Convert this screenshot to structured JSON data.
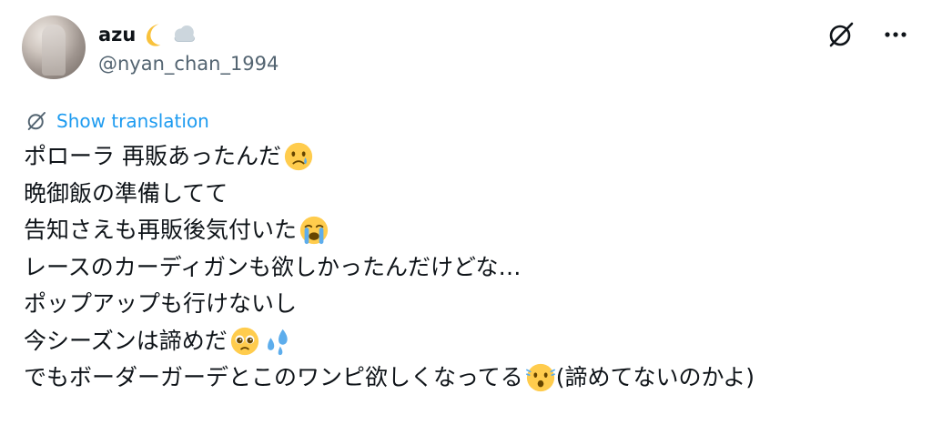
{
  "author": {
    "display_name": "azu",
    "name_emojis": [
      "crescent-moon-icon",
      "cloud-icon"
    ],
    "handle": "@nyan_chan_1994"
  },
  "actions": {
    "grok_icon": "grok-icon",
    "more_icon": "more-icon"
  },
  "translation": {
    "label": "Show translation"
  },
  "tweet": {
    "lines": [
      {
        "text": "ポローラ 再販あったんだ",
        "emoji": "crying-face-icon"
      },
      {
        "text": "晩御飯の準備してて",
        "emoji": ""
      },
      {
        "text": "告知さえも再販後気付いた",
        "emoji": "loudly-crying-face-icon"
      },
      {
        "text": "レースのカーディガンも欲しかったんだけどな…",
        "emoji": ""
      },
      {
        "text": "ポップアップも行けないし",
        "emoji": ""
      },
      {
        "text": "今シーズンは諦めだ",
        "emoji": "pleading-face-icon"
      },
      {
        "text": "でもボーダーガーデとこのワンピ欲しくなってる",
        "emoji": "anxious-face-icon",
        "suffix": "(諦めてないのかよ)"
      }
    ]
  },
  "colors": {
    "text": "#0f1419",
    "secondary": "#536471",
    "link": "#1d9bf0",
    "background": "#ffffff"
  }
}
